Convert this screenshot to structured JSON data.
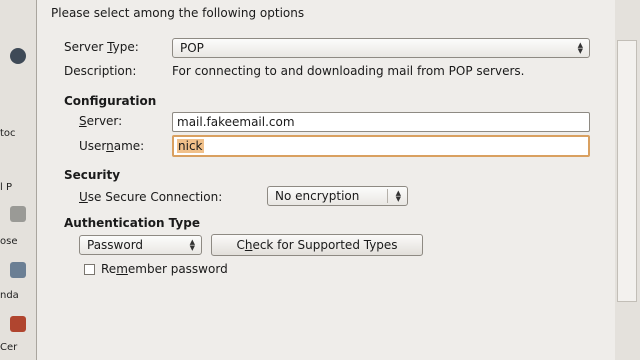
{
  "background_window": {
    "fragments": [
      "toc",
      "l P",
      "ose",
      "nda",
      "Cer"
    ]
  },
  "dialog": {
    "intro": "Please select among the following options",
    "server_type_label": "Server Type:",
    "server_type_value": "POP",
    "description_label": "Description:",
    "description_text": "For connecting to and downloading mail from POP servers.",
    "configuration_title": "Configuration",
    "server_label": "Server:",
    "server_value": "mail.fakeemail.com",
    "username_label": "Username:",
    "username_value": "nick",
    "security_title": "Security",
    "secure_conn_label": "Use Secure Connection:",
    "secure_conn_value": "No encryption",
    "auth_title": "Authentication Type",
    "auth_value": "Password",
    "check_types_button": "Check for Supported Types",
    "remember_password_label": "Remember password",
    "remember_password_checked": false
  }
}
